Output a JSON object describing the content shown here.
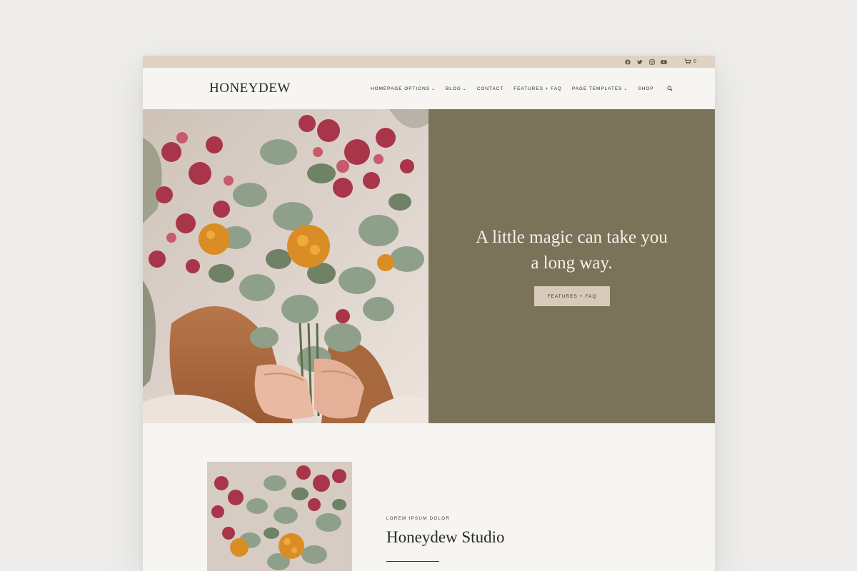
{
  "topbar": {
    "social_icons": [
      "facebook-icon",
      "twitter-icon",
      "instagram-icon",
      "youtube-icon"
    ],
    "cart_count": "0"
  },
  "header": {
    "logo": "HONEYDEW",
    "nav": [
      {
        "label": "HOMEPAGE OPTIONS",
        "dropdown": true
      },
      {
        "label": "BLOG",
        "dropdown": true
      },
      {
        "label": "CONTACT",
        "dropdown": false
      },
      {
        "label": "FEATURES + FAQ",
        "dropdown": false
      },
      {
        "label": "PAGE TEMPLATES",
        "dropdown": true
      },
      {
        "label": "SHOP",
        "dropdown": false
      }
    ]
  },
  "hero": {
    "title": "A little magic can take you a long way.",
    "button_label": "FEATURES + FAQ"
  },
  "section": {
    "eyebrow": "LOREM IPSUM DOLOR",
    "title": "Honeydew Studio"
  },
  "colors": {
    "topbar": "#e0d3c3",
    "page": "#f7f5f1",
    "hero_panel": "#7a735a",
    "button": "#d8cab8",
    "text": "#2b2a28"
  }
}
